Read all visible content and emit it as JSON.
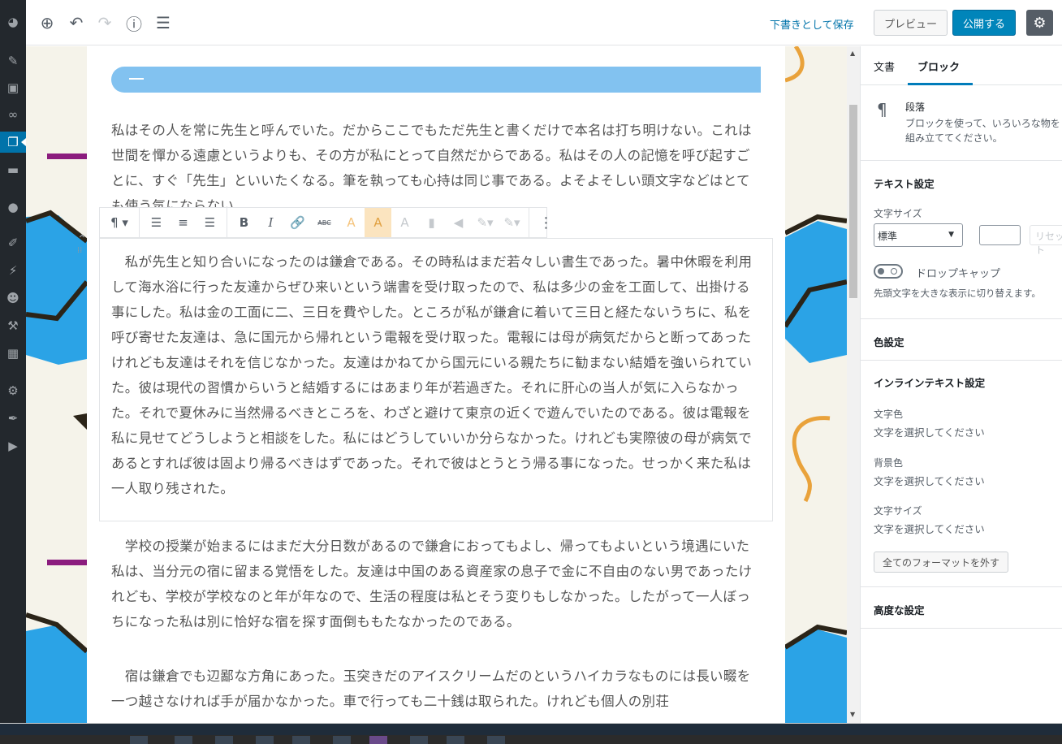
{
  "toolbar": {
    "save_draft": "下書きとして保存",
    "preview": "プレビュー",
    "publish": "公開する"
  },
  "block_toolbar": {
    "bold": "B",
    "italic": "I",
    "abc": "ABC"
  },
  "editor": {
    "paragraphs": [
      "私はその人を常に先生と呼んでいた。だからここでもただ先生と書くだけで本名は打ち明けない。これは世間を憚かる遠慮というよりも、その方が私にとって自然だからである。私はその人の記憶を呼び起すごとに、すぐ「先生」といいたくなる。筆を執っても心持は同じ事である。よそよそしい頭文字などはとても使う気にならない。",
      "　私が先生と知り合いになったのは鎌倉である。その時私はまだ若々しい書生であった。暑中休暇を利用して海水浴に行った友達からぜひ来いという端書を受け取ったので、私は多少の金を工面して、出掛ける事にした。私は金の工面に二、三日を費やした。ところが私が鎌倉に着いて三日と経たないうちに、私を呼び寄せた友達は、急に国元から帰れという電報を受け取った。電報には母が病気だからと断ってあったけれども友達はそれを信じなかった。友達はかねてから国元にいる親たちに勧まない結婚を強いられていた。彼は現代の習慣からいうと結婚するにはあまり年が若過ぎた。それに肝心の当人が気に入らなかった。それで夏休みに当然帰るべきところを、わざと避けて東京の近くで遊んでいたのである。彼は電報を私に見せてどうしようと相談をした。私にはどうしていいか分らなかった。けれども実際彼の母が病気であるとすれば彼は固より帰るべきはずであった。それで彼はとうとう帰る事になった。せっかく来た私は一人取り残された。",
      "　学校の授業が始まるにはまだ大分日数があるので鎌倉におってもよし、帰ってもよいという境遇にいた私は、当分元の宿に留まる覚悟をした。友達は中国のある資産家の息子で金に不自由のない男であったけれども、学校が学校なのと年が年なので、生活の程度は私とそう変りもしなかった。したがって一人ぼっちになった私は別に恰好な宿を探す面倒ももたなかったのである。",
      "　宿は鎌倉でも辺鄙な方角にあった。玉突きだのアイスクリームだのというハイカラなものには長い畷を一つ越さなければ手が届かなかった。車で行っても二十銭は取られた。けれども個人の別荘"
    ]
  },
  "sidebar": {
    "tab_document": "文書",
    "tab_block": "ブロック",
    "block_name": "段落",
    "block_desc": "ブロックを使って、いろいろな物を組み立ててください。",
    "text_settings": "テキスト設定",
    "font_size_label": "文字サイズ",
    "font_size_value": "標準",
    "reset": "リセット",
    "drop_cap_label": "ドロップキャップ",
    "drop_cap_help": "先頭文字を大きな表示に切り替えます。",
    "color_settings": "色設定",
    "inline_settings": "インラインテキスト設定",
    "text_color_label": "文字色",
    "text_color_help": "文字を選択してください",
    "bg_color_label": "背景色",
    "bg_color_help": "文字を選択してください",
    "inline_font_size_label": "文字サイズ",
    "inline_font_size_help": "文字を選択してください",
    "clear_format": "全てのフォーマットを外す",
    "advanced": "高度な設定"
  },
  "colors": {
    "accent": "#0085ba",
    "heading_bar": "#82c2f0",
    "deco_blue": "#2ba3e6",
    "deco_orange": "#e9a23b",
    "deco_purple": "#8b1c7e"
  }
}
